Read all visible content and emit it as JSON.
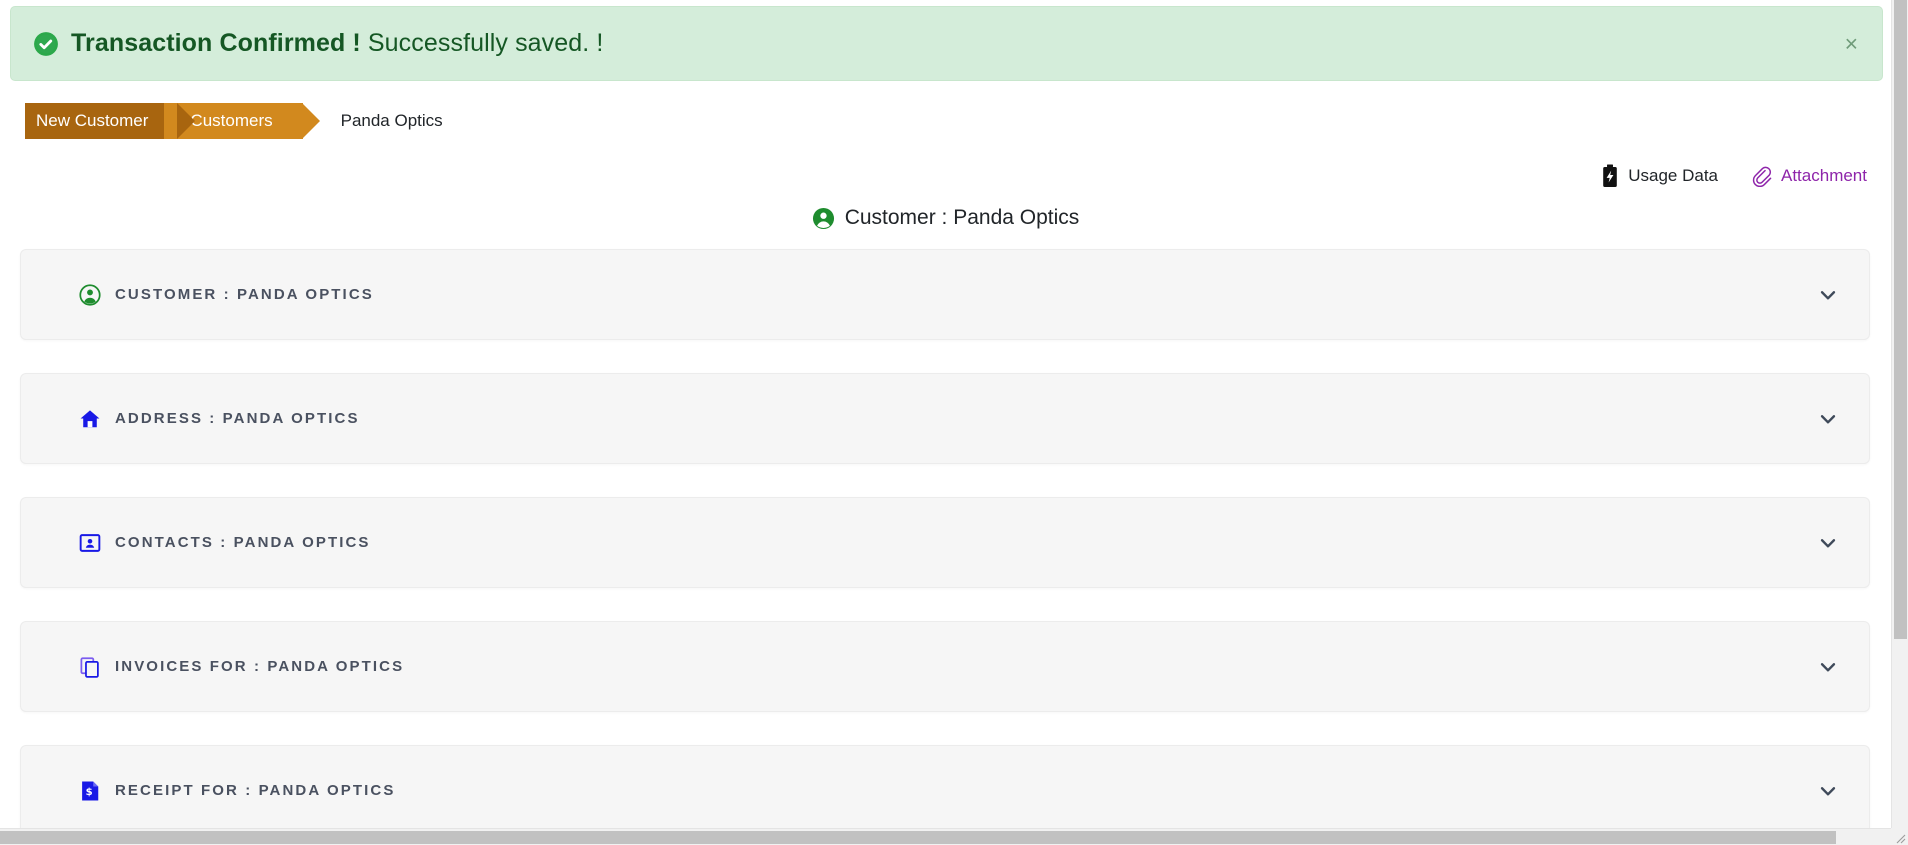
{
  "alert": {
    "icon": "check-circle-icon",
    "strong_text": "Transaction Confirmed !",
    "message_text": "Successfully saved. !",
    "close_label": "×",
    "background_color": "#d4edda",
    "text_color": "#155724"
  },
  "breadcrumb": {
    "items": [
      {
        "label": "New Customer",
        "color": "#a8650f",
        "active": true
      },
      {
        "label": "Customers",
        "color": "#d2891e",
        "active": true
      }
    ],
    "current": "Panda Optics"
  },
  "actionbar": {
    "usage_data": {
      "label": "Usage Data",
      "icon": "battery-icon",
      "color": "#212529"
    },
    "attachment": {
      "label": "Attachment",
      "icon": "paperclip-icon",
      "color": "#8e24aa"
    }
  },
  "page_heading": {
    "icon": "account-circle-icon",
    "icon_color": "#1e8c2e",
    "text": "Customer : Panda Optics"
  },
  "panels": [
    {
      "title": "CUSTOMER : PANDA OPTICS",
      "icon": "account-circle-icon",
      "icon_color": "#1e8c2e",
      "chevron": "chevron-down-icon",
      "expanded": false
    },
    {
      "title": "ADDRESS : PANDA OPTICS",
      "icon": "home-icon",
      "icon_color": "#1919e6",
      "chevron": "chevron-down-icon",
      "expanded": false
    },
    {
      "title": "CONTACTS : PANDA OPTICS",
      "icon": "contact-card-icon",
      "icon_color": "#1919e6",
      "chevron": "chevron-down-icon",
      "expanded": false
    },
    {
      "title": "INVOICES FOR : PANDA OPTICS",
      "icon": "copy-pages-icon",
      "icon_color": "#1919e6",
      "chevron": "chevron-down-icon",
      "expanded": false
    },
    {
      "title": "RECEIPT FOR : PANDA OPTICS",
      "icon": "receipt-dollar-icon",
      "icon_color": "#1919e6",
      "chevron": "chevron-down-icon",
      "expanded": false
    }
  ],
  "scrollbars": {
    "vertical_visible": true,
    "horizontal_visible": true
  }
}
